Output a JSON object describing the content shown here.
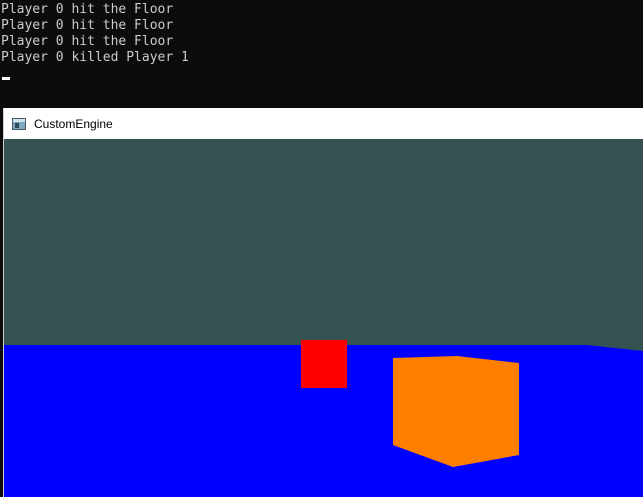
{
  "console": {
    "lines": [
      "Player 0 hit the Floor",
      "Player 0 hit the Floor",
      "Player 0 hit the Floor",
      "Player 0 killed Player 1"
    ]
  },
  "window": {
    "title": "CustomEngine",
    "icon": "application-window-icon"
  },
  "scene": {
    "colors": {
      "sky": "#355151",
      "floor": "#0000fe",
      "red_cube": "#fe0000",
      "orange_cube": "#fe7f00"
    }
  }
}
